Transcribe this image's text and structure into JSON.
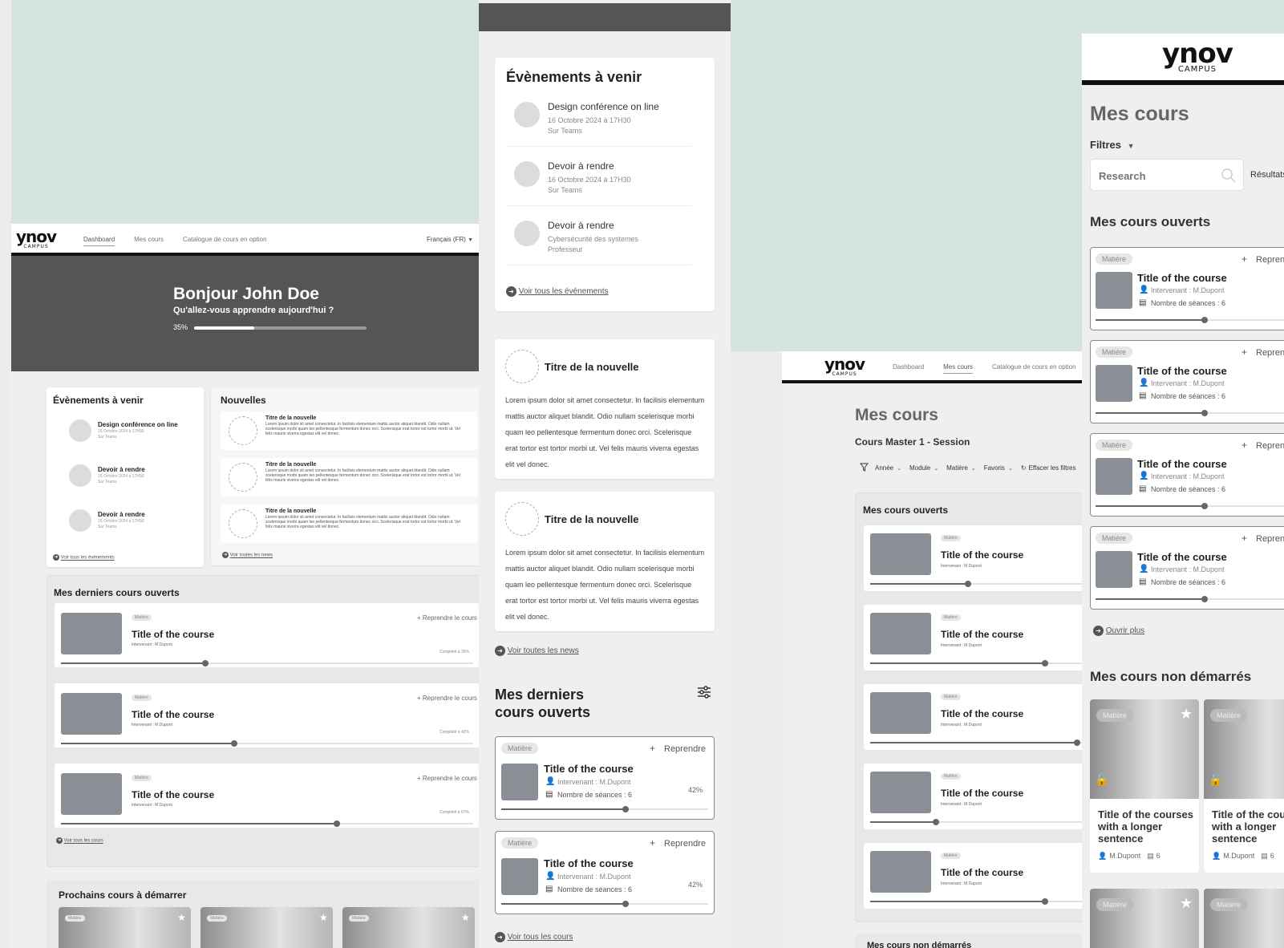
{
  "brand": {
    "logo": "ynov",
    "sub": "CAMPUS"
  },
  "colors": {
    "mint": "#d5e4e1",
    "dark_header": "#555555",
    "thumb": "#898f95",
    "page_bg": "#ececec"
  },
  "s1": {
    "nav": {
      "dashboard": "Dashboard",
      "mes_cours": "Mes cours",
      "catalogue": "Catalogue de cours en option",
      "lang": "Français (FR)"
    },
    "hero": {
      "title": "Bonjour John Doe",
      "subtitle": "Qu'allez-vous apprendre aujourd'hui ?",
      "progress_label": "35%",
      "progress": 0.35
    },
    "events": {
      "title": "Évènements à venir",
      "items": [
        {
          "title": "Design conférence on line",
          "date": "16 Octobre 2024 à 17H30",
          "place": "Sur Teams"
        },
        {
          "title": "Devoir à rendre",
          "date": "16 Octobre 2024 à 17H30",
          "place": "Sur Teams"
        },
        {
          "title": "Devoir à rendre",
          "date": "16 Octobre 2024 à 17H30",
          "place": "Sur Teams"
        }
      ],
      "link": "Voir tous les évènements"
    },
    "news": {
      "title": "Nouvelles",
      "items": [
        {
          "title": "Titre de la nouvelle",
          "body": "Lorem ipsum dolor sit amet consectetur. In facilisis elementum mattis auctor aliquet blandit. Odio nullam scelerisque morbi quam leo pellentesque fermentum donec orci. Scelerisque erat tortor est tortor morbi ut. Vel felis mauris viverra egestas elit vel donec."
        },
        {
          "title": "Titre de la nouvelle",
          "body": "Lorem ipsum dolor sit amet consectetur. In facilisis elementum mattis auctor aliquet blandit. Odio nullam scelerisque morbi quam leo pellentesque fermentum donec orci. Scelerisque erat tortor est tortor morbi ut. Vel felis mauris viverra egestas elit vel donec."
        },
        {
          "title": "Titre de la nouvelle",
          "body": "Lorem ipsum dolor sit amet consectetur. In facilisis elementum mattis auctor aliquet blandit. Odio nullam scelerisque morbi quam leo pellentesque fermentum donec orci. Scelerisque erat tortor est tortor morbi ut. Vel felis mauris viverra egestas elit vel donec."
        }
      ],
      "link": "Voir toutes les news"
    },
    "last_courses": {
      "title": "Mes derniers cours ouverts",
      "items": [
        {
          "tag": "Matière",
          "title": "Title of the course",
          "teacher": "Intervenant : M.Dupont",
          "action": "+ Reprendre le cours",
          "completed": "Complété à 35%",
          "progress": 0.35
        },
        {
          "tag": "Matière",
          "title": "Title of the course",
          "teacher": "Intervenant : M.Dupont",
          "action": "+ Reprendre le cours",
          "completed": "Complété à 42%",
          "progress": 0.42
        },
        {
          "tag": "Matière",
          "title": "Title of the course",
          "teacher": "Intervenant : M.Dupont",
          "action": "+ Reprendre le cours",
          "completed": "Complété à 67%",
          "progress": 0.67
        }
      ],
      "link": "Voir tous les cours"
    },
    "next_courses": {
      "title": "Prochains cours à démarrer",
      "tags": [
        "Matière",
        "Matière",
        "Matière"
      ]
    }
  },
  "s2": {
    "events": {
      "title": "Évènements à venir",
      "items": [
        {
          "title": "Design conférence on line",
          "l1": "16 Octobre 2024 à 17H30",
          "l2": "Sur Teams"
        },
        {
          "title": "Devoir à rendre",
          "l1": "16 Octobre 2024 à 17H30",
          "l2": "Sur Teams"
        },
        {
          "title": "Devoir à rendre",
          "l1": "Cybersécurité des systemes",
          "l2": "Professeur"
        }
      ],
      "link": "Voir tous les évènements"
    },
    "news": [
      {
        "title": "Titre de la nouvelle",
        "body": "Lorem ipsum dolor sit amet consectetur. In facilisis elementum mattis auctor aliquet blandit. Odio nullam scelerisque morbi quam leo pellentesque fermentum donec orci. Scelerisque erat tortor est tortor morbi ut. Vel felis mauris viverra egestas elit vel donec."
      },
      {
        "title": "Titre de la nouvelle",
        "body": "Lorem ipsum dolor sit amet consectetur. In facilisis elementum mattis auctor aliquet blandit. Odio nullam scelerisque morbi quam leo pellentesque fermentum donec orci. Scelerisque erat tortor est tortor morbi ut. Vel felis mauris viverra egestas elit vel donec."
      }
    ],
    "news_link": "Voir toutes les news",
    "last": {
      "title": "Mes derniers\ncours ouverts",
      "items": [
        {
          "tag": "Matière",
          "action": "Reprendre",
          "title": "Title of the course",
          "teacher": "Intervenant : M.Dupont",
          "sessions": "Nombre de séances : 6",
          "pct": "42%",
          "progress": 0.6
        },
        {
          "tag": "Matière",
          "action": "Reprendre",
          "title": "Title of the course",
          "teacher": "Intervenant : M.Dupont",
          "sessions": "Nombre de séances : 6",
          "pct": "42%",
          "progress": 0.6
        }
      ],
      "link": "Voir tous les cours"
    }
  },
  "s3": {
    "nav": {
      "dashboard": "Dashboard",
      "mes_cours": "Mes cours",
      "catalogue": "Catalogue de cours en option"
    },
    "title": "Mes cours",
    "subtitle": "Cours Master 1 - Session",
    "filters": [
      "Année",
      "Module",
      "Matière",
      "Favoris"
    ],
    "clear": "Effacer les filtres",
    "open_title": "Mes cours ouverts",
    "items": [
      {
        "tag": "Matière",
        "title": "Title of the course",
        "teacher": "Intervenant : M.Dupont",
        "progress": 0.45
      },
      {
        "tag": "Matière",
        "title": "Title of the course",
        "teacher": "Intervenant : M.Dupont",
        "progress": 0.8
      },
      {
        "tag": "Matière",
        "title": "Title of the course",
        "teacher": "Intervenant : M.Dupont",
        "progress": 0.95
      },
      {
        "tag": "Matière",
        "title": "Title of the course",
        "teacher": "Intervenant : M.Dupont",
        "progress": 0.3
      },
      {
        "tag": "Matière",
        "title": "Title of the course",
        "teacher": "Intervenant : M.Dupont",
        "progress": 0.8
      }
    ],
    "not_started": "Mes cours non démarrés"
  },
  "s4": {
    "title": "Mes cours",
    "filters_label": "Filtres",
    "search_placeholder": "Research",
    "results": "Résultats",
    "open_title": "Mes cours ouverts",
    "items": [
      {
        "tag": "Matière",
        "action": "Reprendre",
        "title": "Title of the course",
        "teacher": "Intervenant : M.Dupont",
        "sessions": "Nombre de séances : 6",
        "progress": 0.55
      },
      {
        "tag": "Matière",
        "action": "Reprendre",
        "title": "Title of the course",
        "teacher": "Intervenant : M.Dupont",
        "sessions": "Nombre de séances : 6",
        "progress": 0.55
      },
      {
        "tag": "Matière",
        "action": "Reprendre",
        "title": "Title of the course",
        "teacher": "Intervenant : M.Dupont",
        "sessions": "Nombre de séances : 6",
        "progress": 0.55
      },
      {
        "tag": "Matière",
        "action": "Reprendre",
        "title": "Title of the course",
        "teacher": "Intervenant : M.Dupont",
        "sessions": "Nombre de séances : 6",
        "progress": 0.55
      }
    ],
    "more": "Ouvrir plus",
    "not_started_title": "Mes cours non démarrés",
    "ns_cards": [
      {
        "tag": "Matière",
        "title": "Title of the courses with a longer sentence",
        "teacher": "M.Dupont",
        "count": "6"
      },
      {
        "tag": "Matière",
        "title": "Title of the courses with a longer sentence",
        "teacher": "M.Dupont",
        "count": "6"
      }
    ],
    "ns_tags2": [
      "Matière",
      "Matière"
    ]
  }
}
